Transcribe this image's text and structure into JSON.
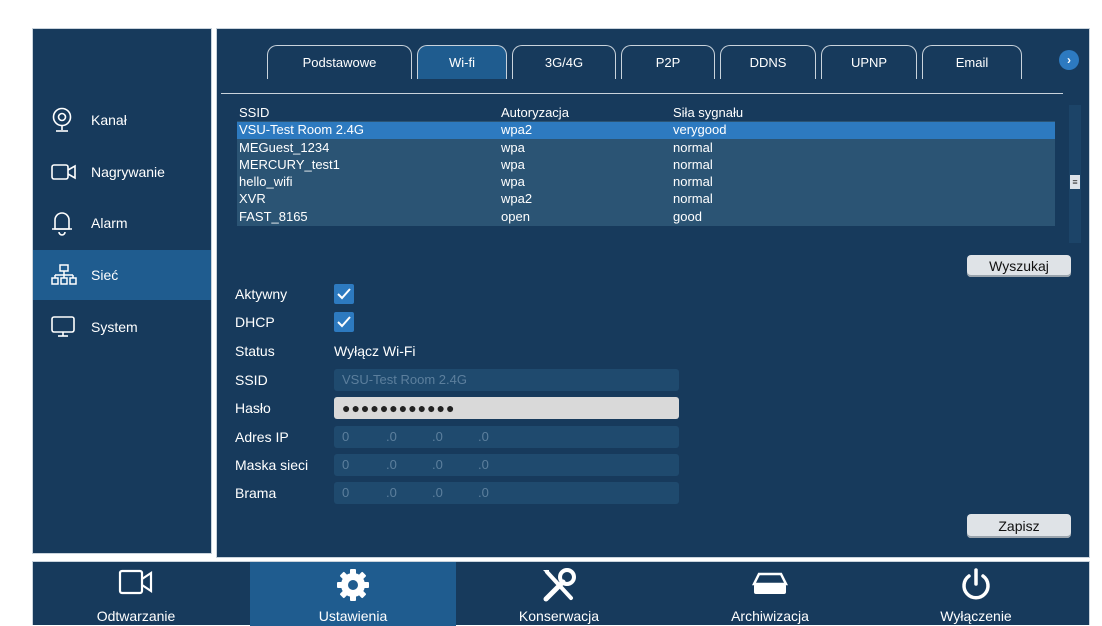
{
  "sidebar": {
    "items": [
      {
        "label": "Kanał",
        "icon": "camera-icon"
      },
      {
        "label": "Nagrywanie",
        "icon": "video-camera-icon"
      },
      {
        "label": "Alarm",
        "icon": "bell-icon"
      },
      {
        "label": "Sieć",
        "icon": "network-icon",
        "active": true
      },
      {
        "label": "System",
        "icon": "monitor-icon"
      }
    ]
  },
  "tabs": [
    {
      "label": "Podstawowe"
    },
    {
      "label": "Wi-fi",
      "active": true
    },
    {
      "label": "3G/4G"
    },
    {
      "label": "P2P"
    },
    {
      "label": "DDNS"
    },
    {
      "label": "UPNP"
    },
    {
      "label": "Email"
    }
  ],
  "wifi_table": {
    "headers": [
      "SSID",
      "Autoryzacja",
      "Siła sygnału"
    ],
    "rows": [
      [
        "VSU-Test Room 2.4G",
        "wpa2",
        "verygood"
      ],
      [
        "MEGuest_1234",
        "wpa",
        "normal"
      ],
      [
        "MERCURY_test1",
        "wpa",
        "normal"
      ],
      [
        "hello_wifi",
        "wpa",
        "normal"
      ],
      [
        "XVR",
        "wpa2",
        "normal"
      ],
      [
        "FAST_8165",
        "open",
        "good"
      ]
    ],
    "selected_row": 0,
    "scroll_thumb": "≡"
  },
  "buttons": {
    "search": "Wyszukaj",
    "save": "Zapisz"
  },
  "form": {
    "active_label": "Aktywny",
    "dhcp_label": "DHCP",
    "status_label": "Status",
    "status_value": "Wyłącz Wi-Fi",
    "ssid_label": "SSID",
    "ssid_value": "VSU-Test Room 2.4G",
    "password_label": "Hasło",
    "password_value": "●●●●●●●●●●●●",
    "ip_label": "Adres IP",
    "mask_label": "Maska sieci",
    "gateway_label": "Brama",
    "ip_value": [
      "0",
      ".0",
      ".0",
      ".0"
    ],
    "mask_value": [
      "0",
      ".0",
      ".0",
      ".0"
    ],
    "gateway_value": [
      "0",
      ".0",
      ".0",
      ".0"
    ]
  },
  "bottom": [
    {
      "label": "Odtwarzanie",
      "icon": "playback-icon"
    },
    {
      "label": "Ustawienia",
      "icon": "gear-icon",
      "active": true
    },
    {
      "label": "Konserwacja",
      "icon": "tools-icon"
    },
    {
      "label": "Archiwizacja",
      "icon": "archive-drive-icon"
    },
    {
      "label": "Wyłączenie",
      "icon": "power-icon"
    }
  ],
  "colors": {
    "panel": "#173a5c",
    "active": "#1f5c8f",
    "accent": "#2d7ac0"
  }
}
